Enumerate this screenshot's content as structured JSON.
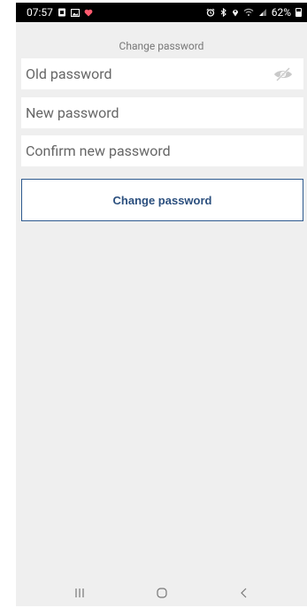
{
  "status_bar": {
    "time": "07:57",
    "battery": "62%",
    "left_icons": [
      "sim-icon",
      "gallery-icon",
      "heart-icon"
    ],
    "right_icons": [
      "alarm-icon",
      "bluetooth-icon",
      "location-icon",
      "wifi-icon",
      "signal-icon",
      "battery-icon"
    ]
  },
  "page": {
    "title": "Change password"
  },
  "form": {
    "old_password": {
      "placeholder": "Old password",
      "value": ""
    },
    "new_password": {
      "placeholder": "New password",
      "value": ""
    },
    "confirm_password": {
      "placeholder": "Confirm new password",
      "value": ""
    },
    "toggle_icon": "eye-off-icon",
    "submit_label": "Change password"
  },
  "nav_bar": {
    "buttons": [
      "recents-icon",
      "home-icon",
      "back-icon"
    ]
  },
  "colors": {
    "accent": "#2b4f7e",
    "background": "#efefef",
    "status_bar": "#000000"
  }
}
